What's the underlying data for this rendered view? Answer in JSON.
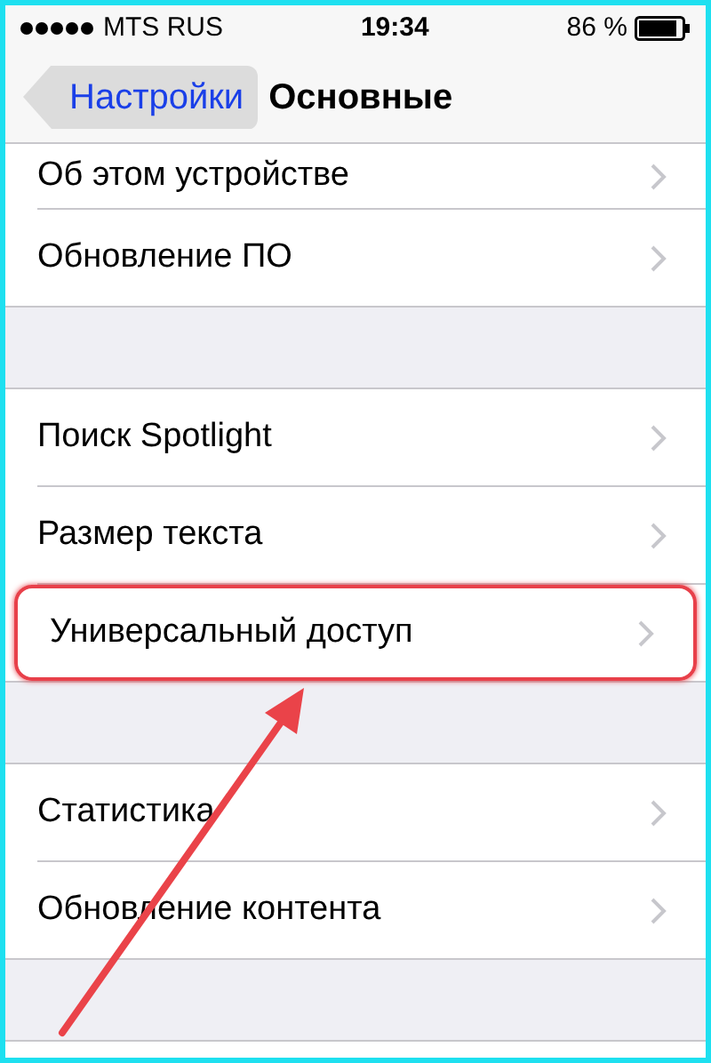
{
  "status_bar": {
    "carrier": "MTS RUS",
    "time": "19:34",
    "battery": "86 %"
  },
  "nav_bar": {
    "back": "Настройки",
    "title": "Основные"
  },
  "groups": [
    {
      "items": [
        {
          "label": "Об этом устройстве",
          "highlighted": false
        },
        {
          "label": "Обновление ПО",
          "highlighted": false
        }
      ]
    },
    {
      "items": [
        {
          "label": "Поиск Spotlight",
          "highlighted": false
        },
        {
          "label": "Размер текста",
          "highlighted": false
        },
        {
          "label": "Универсальный доступ",
          "highlighted": true
        }
      ]
    },
    {
      "items": [
        {
          "label": "Статистика",
          "highlighted": false
        },
        {
          "label": "Обновление контента",
          "highlighted": false
        }
      ]
    }
  ]
}
